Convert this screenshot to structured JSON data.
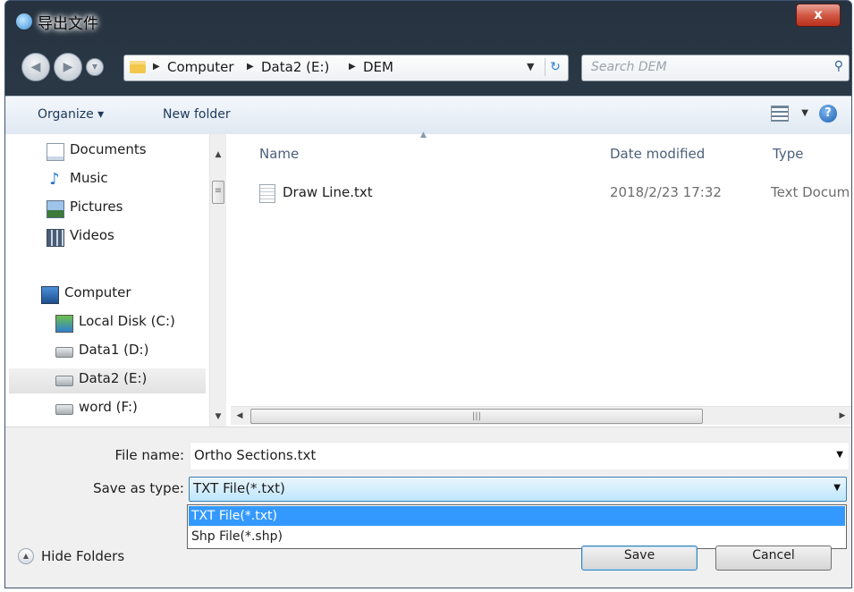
{
  "window": {
    "title": "导出文件",
    "close_label": "x"
  },
  "nav": {
    "back_icon": "back-arrow-icon",
    "forward_icon": "forward-arrow-icon",
    "breadcrumbs": [
      "Computer",
      "Data2 (E:)",
      "DEM"
    ],
    "search_placeholder": "Search DEM"
  },
  "toolbar": {
    "organize_label": "Organize ▾",
    "new_folder_label": "New folder"
  },
  "sidebar": {
    "items": [
      {
        "label": "Documents",
        "icon": "documents-icon"
      },
      {
        "label": "Music",
        "icon": "music-icon"
      },
      {
        "label": "Pictures",
        "icon": "pictures-icon"
      },
      {
        "label": "Videos",
        "icon": "videos-icon"
      },
      {
        "label": "Computer",
        "icon": "computer-icon"
      },
      {
        "label": "Local Disk (C:)",
        "icon": "local-disk-icon"
      },
      {
        "label": "Data1 (D:)",
        "icon": "drive-icon"
      },
      {
        "label": "Data2 (E:)",
        "icon": "drive-icon",
        "selected": true
      },
      {
        "label": "word (F:)",
        "icon": "drive-icon"
      }
    ]
  },
  "files": {
    "columns": [
      "Name",
      "Date modified",
      "Type"
    ],
    "rows": [
      {
        "name": "Draw Line.txt",
        "date": "2018/2/23 17:32",
        "type": "Text Docum"
      }
    ]
  },
  "form": {
    "file_name_label": "File name:",
    "file_name_value": "Ortho Sections.txt",
    "save_type_label": "Save as type:",
    "save_type_value": "TXT File(*.txt)",
    "type_options": [
      "TXT File(*.txt)",
      "Shp File(*.shp)"
    ]
  },
  "footer": {
    "hide_folders_label": "Hide Folders",
    "save_label": "Save",
    "cancel_label": "Cancel"
  }
}
